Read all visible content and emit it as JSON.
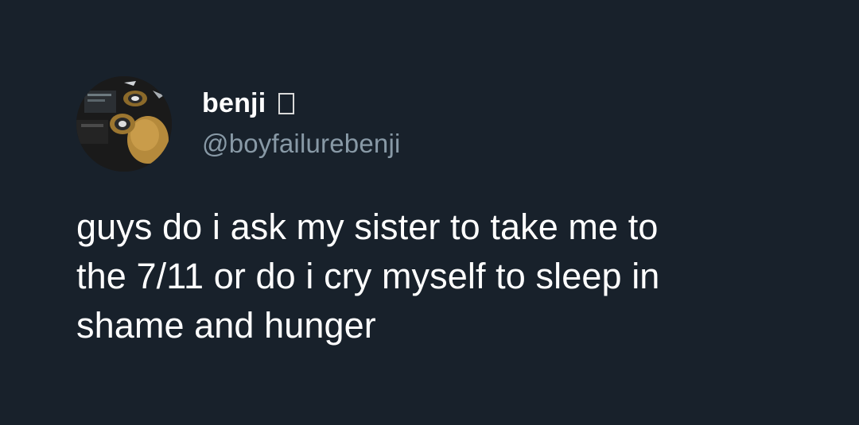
{
  "author": {
    "display_name": "benji",
    "handle": "@boyfailurebenji",
    "avatar_icon": "avatar-photo"
  },
  "tweet": {
    "lines": [
      "guys do i ask my sister to take me to",
      "the 7/11 or do i cry myself to sleep in",
      "shame and hunger"
    ]
  },
  "colors": {
    "background": "#18212b",
    "text_primary": "#ffffff",
    "text_secondary": "#8899a6"
  }
}
